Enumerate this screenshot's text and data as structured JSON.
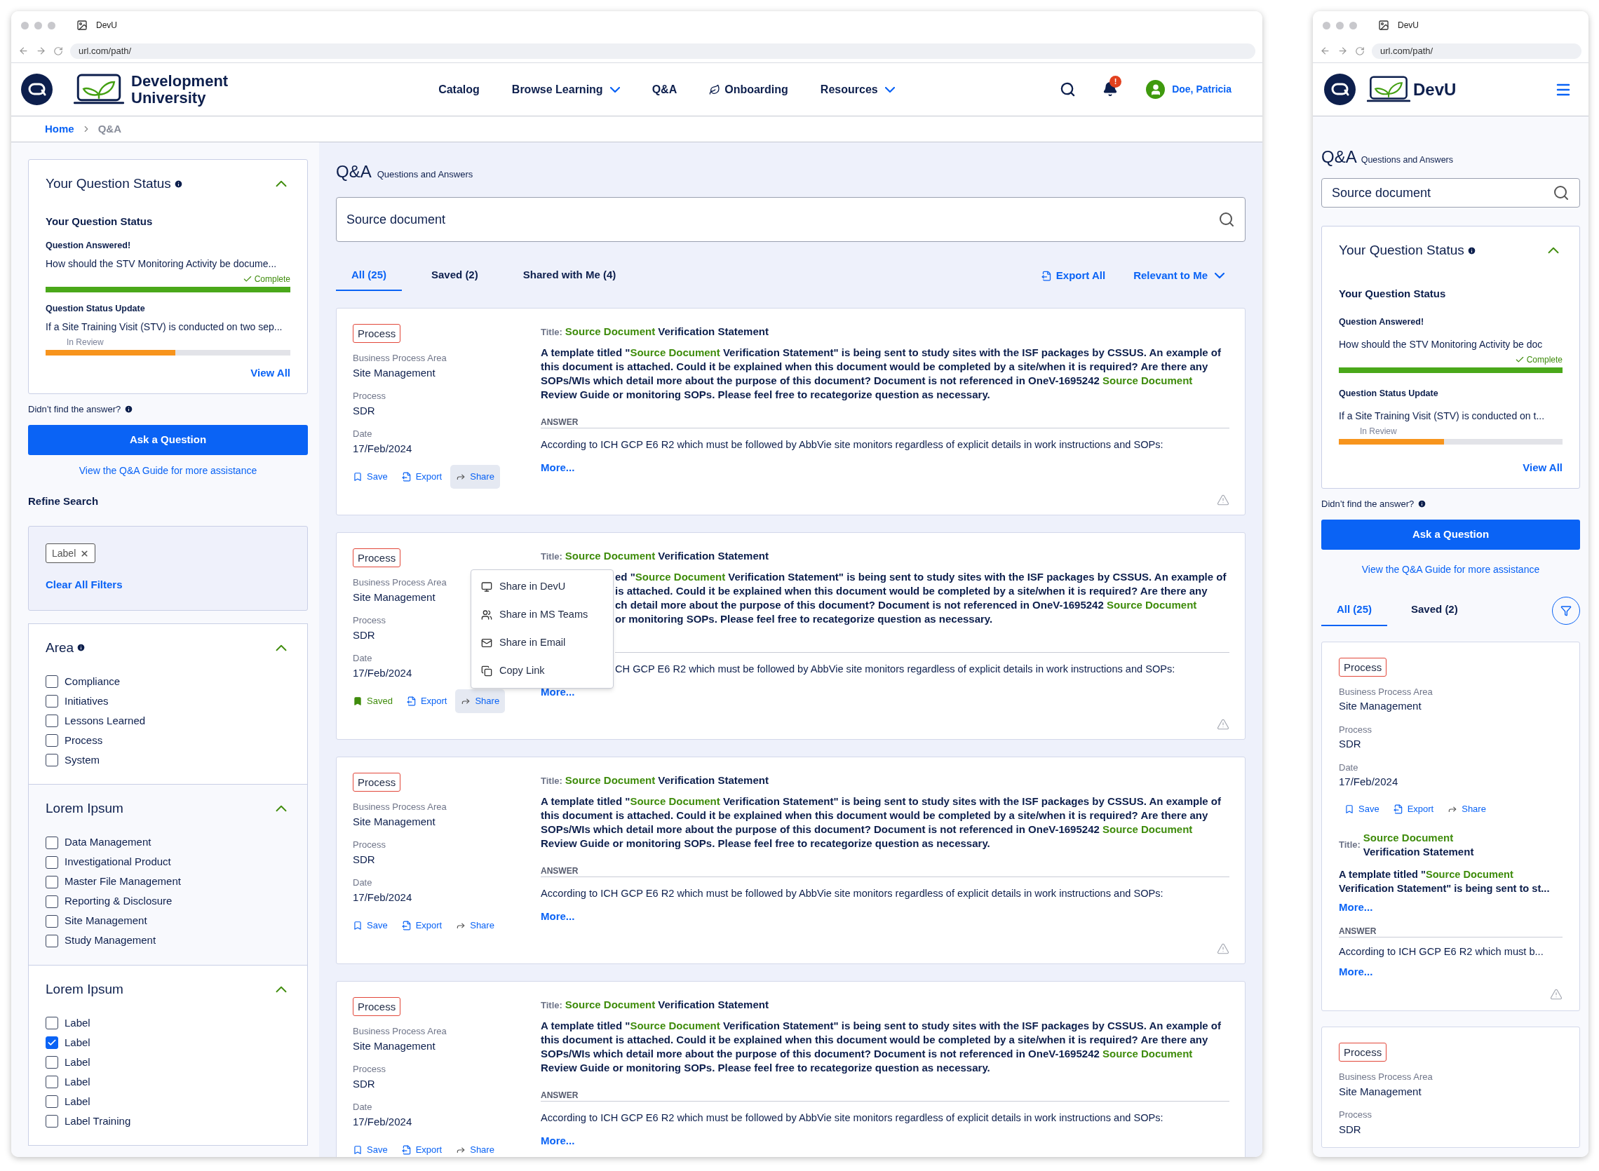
{
  "desktop": {
    "browser": {
      "tab_title": "DevU",
      "url": "url.com/path/"
    },
    "header": {
      "logo_lines": [
        "Development",
        "University"
      ],
      "nav": [
        {
          "label": "Catalog",
          "kind": "link"
        },
        {
          "label": "Browse Learning",
          "kind": "dropdown"
        },
        {
          "label": "Q&A",
          "kind": "link"
        },
        {
          "label": "Onboarding",
          "kind": "leaf"
        },
        {
          "label": "Resources",
          "kind": "dropdown"
        }
      ],
      "notification_badge": "!",
      "user": "Doe, Patricia"
    },
    "breadcrumb": [
      {
        "label": "Home",
        "current": false
      },
      {
        "label": "Q&A",
        "current": true
      }
    ],
    "sidebar": {
      "status": {
        "title": "Your Question Status",
        "expanded": true,
        "subtitle": "Your Question Status",
        "items": [
          {
            "heading": "Question Answered!",
            "text": "How should the STV Monitoring Activity be docume...",
            "status": "Complete",
            "kind": "complete",
            "level": 1
          },
          {
            "heading": "Question Status Update",
            "text": "If a Site Training Visit (STV) is conducted on two sep...",
            "status": "In Review",
            "kind": "review",
            "level": 0.53
          }
        ],
        "view_all": "View All"
      },
      "help": {
        "text": "Didn’t find the answer?",
        "button": "Ask a Question",
        "guide_link": "View the Q&A Guide for more assistance"
      },
      "refine": {
        "title": "Refine Search",
        "chips": [
          "Label"
        ],
        "clear": "Clear All Filters"
      },
      "filter_groups": [
        {
          "title": "Area",
          "info": true,
          "expanded": true,
          "hovered": false,
          "options": [
            {
              "label": "Compliance",
              "checked": false
            },
            {
              "label": "Initiatives",
              "checked": false
            },
            {
              "label": "Lessons Learned",
              "checked": false
            },
            {
              "label": "Process",
              "checked": false
            },
            {
              "label": "System",
              "checked": false
            }
          ]
        },
        {
          "title": "Lorem Ipsum",
          "info": false,
          "expanded": true,
          "hovered": true,
          "options": [
            {
              "label": "Data Management",
              "checked": false
            },
            {
              "label": "Investigational Product",
              "checked": false
            },
            {
              "label": "Master File Management",
              "checked": false
            },
            {
              "label": "Reporting & Disclosure",
              "checked": false
            },
            {
              "label": "Site Management",
              "checked": false
            },
            {
              "label": "Study Management",
              "checked": false
            }
          ]
        },
        {
          "title": "Lorem Ipsum",
          "info": false,
          "expanded": true,
          "hovered": false,
          "options": [
            {
              "label": "Label",
              "checked": false
            },
            {
              "label": "Label",
              "checked": true
            },
            {
              "label": "Label",
              "checked": false
            },
            {
              "label": "Label",
              "checked": false
            },
            {
              "label": "Label",
              "checked": false
            },
            {
              "label": "Label Training",
              "checked": false
            }
          ]
        }
      ]
    },
    "main": {
      "heading": "Q&A",
      "subheading": "Questions and Answers",
      "search": {
        "value": "Source document"
      },
      "tabs": [
        {
          "label": "All (25)",
          "selected": true
        },
        {
          "label": "Saved (2)",
          "selected": false
        },
        {
          "label": "Shared with Me (4)",
          "selected": false
        }
      ],
      "export": "Export All",
      "sort": "Relevant to Me",
      "cards": [
        {
          "tag": "Process",
          "fields": [
            {
              "label": "Business Process Area",
              "value": "Site Management"
            },
            {
              "label": "Process",
              "value": "SDR"
            },
            {
              "label": "Date",
              "value": "17/Feb/2024"
            }
          ],
          "actions": [
            {
              "kind": "save",
              "label": "Save",
              "on": false
            },
            {
              "kind": "export",
              "label": "Export"
            },
            {
              "kind": "share",
              "label": "Share",
              "on": true
            }
          ],
          "title_label": "Title:",
          "title": [
            {
              "text": "Source Document",
              "highlight": true
            },
            {
              "text": " Verification Statement",
              "highlight": false
            }
          ],
          "question": [
            {
              "text": "A template titled \"",
              "highlight": false
            },
            {
              "text": "Source Document",
              "highlight": true
            },
            {
              "text": " Verification Statement\" is being sent to study sites with the ISF packages by CSSUS. An example of this document is attached. Could it be explained when this document would be completed by a site/when it is required? Are there any SOPs/WIs which detail more about the purpose of this document? Document is not referenced in OneV-1695242 ",
              "highlight": false
            },
            {
              "text": "Source Document",
              "highlight": true
            },
            {
              "text": " Review Guide or monitoring SOPs. Please feel free to recategorize question as necessary.",
              "highlight": false
            }
          ],
          "answer_label": "ANSWER",
          "answer": "According to ICH GCP E6 R2 which must be followed by AbbVie site monitors regardless of explicit details in work instructions and SOPs:",
          "more": "More..."
        },
        {
          "tag": "Process",
          "fields": [
            {
              "label": "Business Process Area",
              "value": "Site Management"
            },
            {
              "label": "Process",
              "value": "SDR"
            },
            {
              "label": "Date",
              "value": "17/Feb/2024"
            }
          ],
          "actions": [
            {
              "kind": "save",
              "label": "Saved",
              "on": true
            },
            {
              "kind": "export",
              "label": "Export"
            },
            {
              "kind": "share",
              "label": "Share",
              "on": true
            }
          ],
          "title_label": "Title:",
          "title": [
            {
              "text": "Source Document",
              "highlight": true
            },
            {
              "text": " Verification Statement",
              "highlight": false
            }
          ],
          "question_lines": [
            [
              {
                "text": "ed \"",
                "highlight": false
              },
              {
                "text": "Source Document",
                "highlight": true
              },
              {
                "text": " Verification Statement\" is being sent to study sites with the ISF packages by CSSUS. An example of",
                "highlight": false
              }
            ],
            [
              {
                "text": "is attached. Could it be explained when this document would be completed by a site/when it is required? Are there any",
                "highlight": false
              }
            ],
            [
              {
                "text": "ch detail more about the purpose of this document? Document is not referenced in OneV-1695242 ",
                "highlight": false
              },
              {
                "text": "Source Document",
                "highlight": true
              }
            ],
            [
              {
                "text": "or monitoring SOPs. Please feel free to recategorize question as necessary.",
                "highlight": false
              }
            ]
          ],
          "answer": "CH GCP E6 R2 which must be followed by AbbVie site monitors regardless of explicit details in work instructions and SOPs:",
          "more": "More...",
          "share_menu": [
            {
              "label": "Share in DevU",
              "kind": "devu"
            },
            {
              "label": "Share in MS Teams",
              "kind": "teams"
            },
            {
              "label": "Share in Email",
              "kind": "email"
            },
            {
              "label": "Copy Link",
              "kind": "link"
            }
          ]
        },
        {
          "tag": "Process",
          "fields": [
            {
              "label": "Business Process Area",
              "value": "Site Management"
            },
            {
              "label": "Process",
              "value": "SDR"
            },
            {
              "label": "Date",
              "value": "17/Feb/2024"
            }
          ],
          "actions": [
            {
              "kind": "save",
              "label": "Save",
              "on": false
            },
            {
              "kind": "export",
              "label": "Export"
            },
            {
              "kind": "share",
              "label": "Share",
              "on": false
            }
          ],
          "title_label": "Title:",
          "title": [
            {
              "text": "Source Document",
              "highlight": true
            },
            {
              "text": " Verification Statement",
              "highlight": false
            }
          ],
          "question": [
            {
              "text": "A template titled \"",
              "highlight": false
            },
            {
              "text": "Source Document",
              "highlight": true
            },
            {
              "text": " Verification Statement\" is being sent to study sites with the ISF packages by CSSUS. An example of this document is attached. Could it be explained when this document would be completed by a site/when it is required? Are there any SOPs/WIs which detail more about the purpose of this document? Document is not referenced in OneV-1695242 ",
              "highlight": false
            },
            {
              "text": "Source Document",
              "highlight": true
            },
            {
              "text": " Review Guide or monitoring SOPs. Please feel free to recategorize question as necessary.",
              "highlight": false
            }
          ],
          "answer_label": "ANSWER",
          "answer": "According to ICH GCP E6 R2 which must be followed by AbbVie site monitors regardless of explicit details in work instructions and SOPs:",
          "more": "More..."
        },
        {
          "tag": "Process",
          "fields": [
            {
              "label": "Business Process Area",
              "value": "Site Management"
            },
            {
              "label": "Process",
              "value": "SDR"
            },
            {
              "label": "Date",
              "value": "17/Feb/2024"
            }
          ],
          "actions": [
            {
              "kind": "save",
              "label": "Save",
              "on": false
            },
            {
              "kind": "export",
              "label": "Export"
            },
            {
              "kind": "share",
              "label": "Share",
              "on": false
            }
          ],
          "title_label": "Title:",
          "title": [
            {
              "text": "Source Document",
              "highlight": true
            },
            {
              "text": " Verification Statement",
              "highlight": false
            }
          ],
          "question": [
            {
              "text": "A template titled \"",
              "highlight": false
            },
            {
              "text": "Source Document",
              "highlight": true
            },
            {
              "text": " Verification Statement\" is being sent to study sites with the ISF packages by CSSUS. An example of this document is attached. Could it be explained when this document would be completed by a site/when it is required? Are there any SOPs/WIs which detail more about the purpose of this document? Document is not referenced in OneV-1695242 ",
              "highlight": false
            },
            {
              "text": "Source Document",
              "highlight": true
            },
            {
              "text": " Review Guide or monitoring SOPs. Please feel free to recategorize question as necessary.",
              "highlight": false
            }
          ],
          "answer_label": "ANSWER",
          "answer": "According to ICH GCP E6 R2 which must be followed by AbbVie site monitors regardless of explicit details in work instructions and SOPs:",
          "more": "More..."
        }
      ]
    }
  },
  "mobile": {
    "browser": {
      "tab_title": "DevU",
      "url": "url.com/path/"
    },
    "header": {
      "logo_text": "DevU"
    },
    "heading": "Q&A",
    "subheading": "Questions and Answers",
    "search": {
      "value": "Source document"
    },
    "status": {
      "title": "Your Question Status",
      "expanded": true,
      "subtitle": "Your Question Status",
      "items": [
        {
          "heading": "Question Answered!",
          "text": "How should the STV Monitoring Activity be doc",
          "status": "Complete",
          "kind": "complete",
          "level": 1
        },
        {
          "heading": "Question Status Update",
          "text": "If a Site Training Visit (STV) is conducted on t...",
          "status": "In Review",
          "kind": "review",
          "level": 0.47
        }
      ],
      "view_all": "View All"
    },
    "help": {
      "text": "Didn’t find the answer?",
      "button": "Ask a Question",
      "guide_link": "View the Q&A Guide for more assistance"
    },
    "tabs": [
      {
        "label": "All (25)",
        "selected": true
      },
      {
        "label": "Saved (2)",
        "selected": false
      }
    ],
    "cards": [
      {
        "tag": "Process",
        "fields": [
          {
            "label": "Business Process Area",
            "value": "Site Management"
          },
          {
            "label": "Process",
            "value": "SDR"
          },
          {
            "label": "Date",
            "value": "17/Feb/2024"
          }
        ],
        "actions": [
          {
            "kind": "save",
            "label": "Save",
            "on": false
          },
          {
            "kind": "export",
            "label": "Export"
          },
          {
            "kind": "share",
            "label": "Share",
            "on": false
          }
        ],
        "title_label": "Title:",
        "title": [
          {
            "text": "Source Document",
            "highlight": true
          },
          {
            "text": " Verification Statement",
            "highlight": false
          }
        ],
        "question": [
          {
            "text": "A template titled \"",
            "highlight": false
          },
          {
            "text": "Source Document",
            "highlight": true
          },
          {
            "text": " Verification Statement\" is being sent to st...",
            "highlight": false
          }
        ],
        "question_more": "More...",
        "answer_label": "ANSWER",
        "answer": "According to ICH GCP E6 R2 which must b...",
        "more": "More..."
      },
      {
        "tag": "Process",
        "fields": [
          {
            "label": "Business Process Area",
            "value": "Site Management"
          },
          {
            "label": "Process",
            "value": "SDR"
          }
        ]
      }
    ]
  }
}
